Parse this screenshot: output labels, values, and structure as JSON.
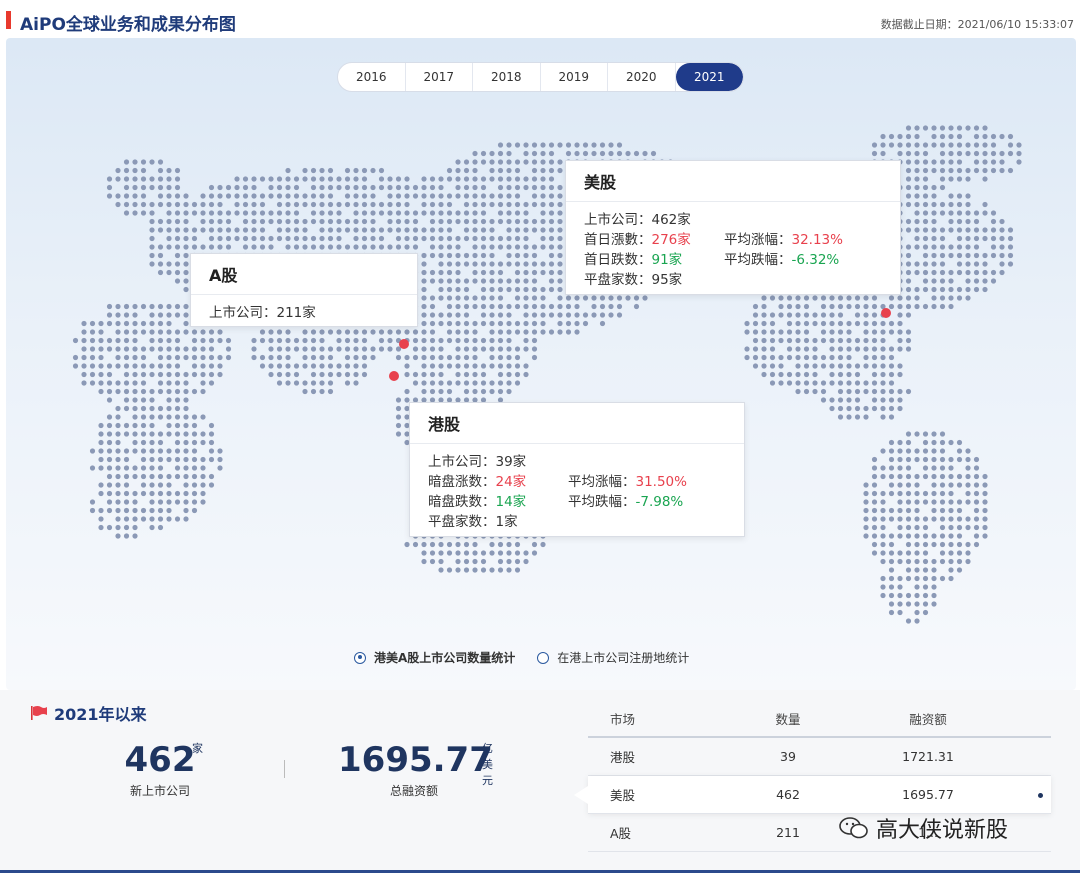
{
  "header": {
    "title": "AiPO全球业务和成果分布图",
    "date": "数据截止日期：2021/06/10 15:33:07"
  },
  "years": [
    "2016",
    "2017",
    "2018",
    "2019",
    "2020",
    "2021"
  ],
  "active_year": "2021",
  "cards": {
    "a": {
      "title": "A股",
      "listed": "上市公司：211家"
    },
    "us": {
      "title": "美股",
      "listed": "上市公司：462家",
      "up_label": "首日漲數：",
      "up_value": "276家",
      "avg_up_label": "平均涨幅：",
      "avg_up_value": "32.13%",
      "down_label": "首日跌数：",
      "down_value": "91家",
      "avg_down_label": "平均跌幅：",
      "avg_down_value": "-6.32%",
      "flat": "平盘家数：95家"
    },
    "hk": {
      "title": "港股",
      "listed": "上市公司：39家",
      "up_label": "暗盘涨数：",
      "up_value": "24家",
      "avg_up_label": "平均涨幅：",
      "avg_up_value": "31.50%",
      "down_label": "暗盘跌数：",
      "down_value": "14家",
      "avg_down_label": "平均跌幅：",
      "avg_down_value": "-7.98%",
      "flat": "平盘家数：1家"
    }
  },
  "radios": [
    {
      "label": "港美A股上市公司数量统计",
      "checked": true
    },
    {
      "label": "在港上市公司注册地统计",
      "checked": false
    }
  ],
  "summary": {
    "title": "2021年以来",
    "count": "462",
    "count_unit": "家",
    "count_label": "新上市公司",
    "amount": "1695.77",
    "amount_unit": "亿美元",
    "amount_label": "总融资额"
  },
  "table": {
    "headers": [
      "市场",
      "数量",
      "融资额"
    ],
    "rows": [
      {
        "market": "港股",
        "count": "39",
        "amount": "1721.31"
      },
      {
        "market": "美股",
        "count": "462",
        "amount": "1695.77"
      },
      {
        "market": "A股",
        "count": "211",
        "amount": "1..."
      }
    ]
  },
  "watermark": "高大侠说新股",
  "colors": {
    "accent": "#1f3b8a",
    "up": "#e8414d",
    "down": "#1aa551",
    "dot": "#8b99b6"
  }
}
